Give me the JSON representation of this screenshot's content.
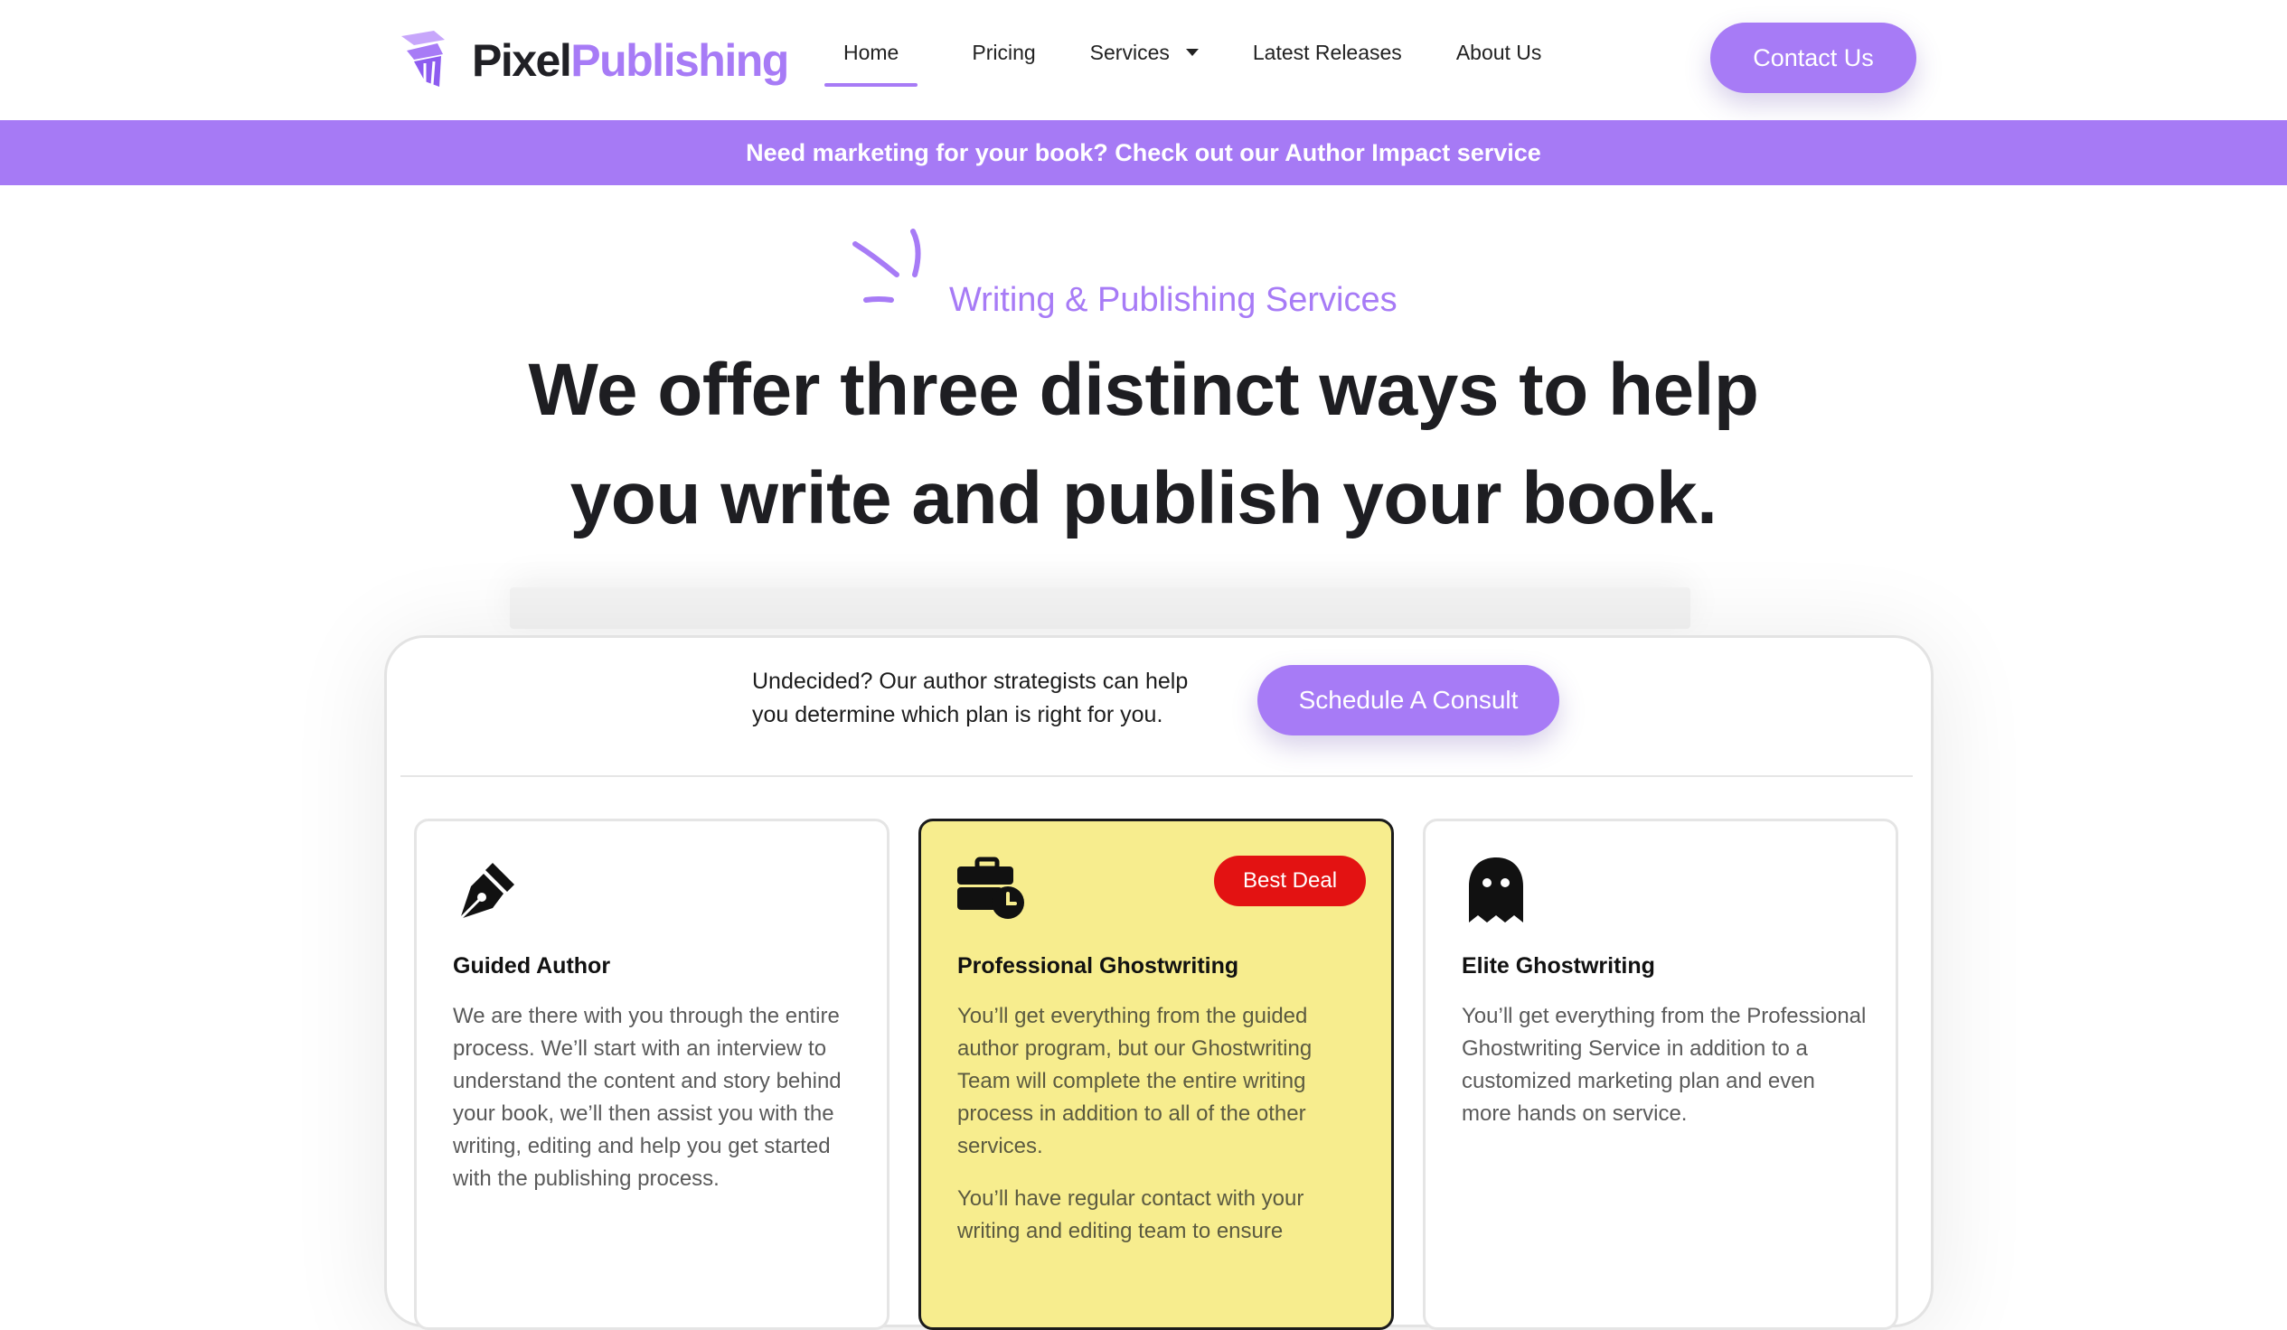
{
  "brand": {
    "name_part1": "Pixel",
    "name_part2": "Publishing",
    "color_dark": "#202025",
    "color_accent": "#a77bf6",
    "logo_icon": "folded-pages-logo-icon"
  },
  "nav": {
    "items": [
      {
        "label": "Home",
        "active": true
      },
      {
        "label": "Pricing"
      },
      {
        "label": "Services",
        "has_dropdown": true,
        "dropdown_icon": "caret-down-icon"
      },
      {
        "label": "Latest Releases"
      },
      {
        "label": "About Us"
      }
    ],
    "contact_button": "Contact Us"
  },
  "banner": {
    "text": "Need marketing for your book? Check out our Author Impact service",
    "color": "#a67af5"
  },
  "hero": {
    "eyebrow": "Writing & Publishing Services",
    "headline_line1": "We offer three distinct ways to help",
    "headline_line2": "you write and publish your book.",
    "decoration_icon": "sparkle-lines-icon"
  },
  "consult": {
    "text_line1": "Undecided? Our author strategists can help",
    "text_line2": "you determine which plan is right for you.",
    "button": "Schedule A Consult"
  },
  "plans": [
    {
      "icon": "pen-nib-icon",
      "title": "Guided Author",
      "paragraphs": [
        "We are there with you through the entire process. We’ll start with an interview to understand the content and story behind your book, we’ll then assist you with the writing, editing and help you get started with the publishing process."
      ]
    },
    {
      "icon": "briefcase-clock-icon",
      "title": "Professional Ghostwriting",
      "badge": "Best Deal",
      "highlight_color": "#f7ed8e",
      "paragraphs": [
        "You’ll get everything from the guided author program, but our Ghostwriting Team will complete the entire writing process in addition to all of the other services.",
        "You’ll have regular contact with your writing and editing team to ensure"
      ]
    },
    {
      "icon": "ghost-icon",
      "title": "Elite Ghostwriting",
      "paragraphs": [
        "You’ll get everything from the Professional Ghostwriting Service in addition to a customized marketing plan and even more hands on service."
      ]
    }
  ]
}
